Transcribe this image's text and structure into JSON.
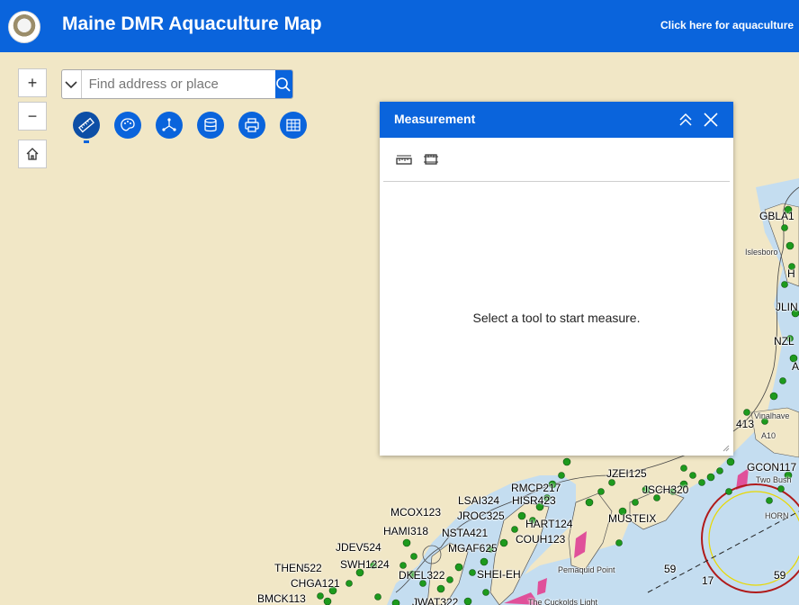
{
  "header": {
    "title": "Maine DMR Aquaculture Map",
    "link_text": "Click here for aquaculture"
  },
  "controls": {
    "zoom_in": "+",
    "zoom_out": "−"
  },
  "search": {
    "placeholder": "Find address or place"
  },
  "toolbar": {
    "tools": [
      "measurement",
      "basemap-gallery",
      "analysis",
      "layer-list",
      "print",
      "attribute-table"
    ],
    "active_tool": "measurement"
  },
  "panel": {
    "title": "Measurement",
    "message": "Select a tool to start measure.",
    "tools": [
      "distance-measure",
      "area-measure"
    ]
  },
  "map": {
    "labels": [
      "GBLA1",
      "Islesboro",
      "H",
      "JLIN",
      "NZL",
      "A",
      "Vinalhave",
      "413",
      "A10",
      "GCON117",
      "RMCP217",
      "JZEI125",
      "JSCH320",
      "LSAI324",
      "HISR423",
      "MCOX123",
      "JROC325",
      "HART124",
      "MUSTEIX",
      "HAMI318",
      "NSTA421",
      "COUH123",
      "MGAF625",
      "JDEV524",
      "THEN522",
      "SWH1224",
      "DKEL322",
      "CHGA121",
      "SHEI-EH",
      "BMCK113",
      "JWAT322",
      "Pemaquid Point",
      "The Cuckolds Light",
      "Two Bush",
      "HORN",
      "59",
      "59",
      "17"
    ],
    "colors": {
      "land": "#f1e7c6",
      "water": "#c4ddf0",
      "site": "#1d9a1d",
      "accent": "#0a64dc"
    }
  }
}
